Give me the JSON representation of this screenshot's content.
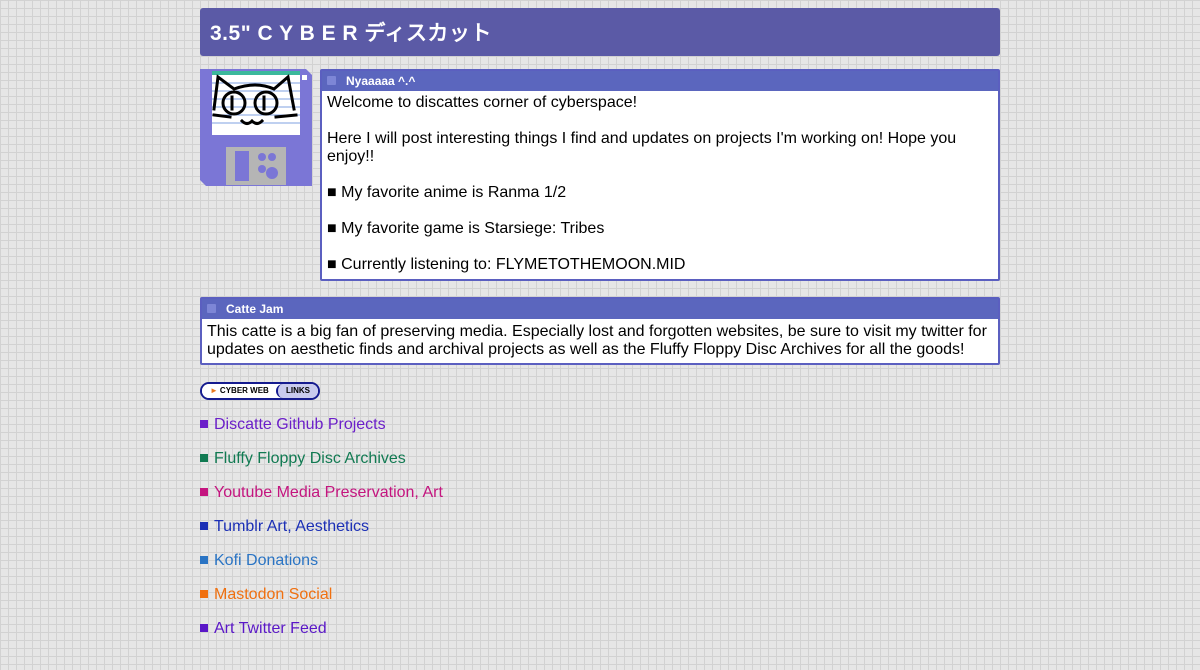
{
  "header": {
    "title": "3.5\" C Y B E R ディスカット"
  },
  "about_window": {
    "title": "Nyaaaaa ^.^",
    "paragraphs": [
      "Welcome to discattes corner of cyberspace!",
      "Here I will post interesting things I find and updates on projects I'm working on! Hope you enjoy!!",
      "■ My favorite anime is Ranma 1/2",
      "■ My favorite game is Starsiege: Tribes",
      "■ Currently listening to: FLYMETOTHEMOON.MID"
    ]
  },
  "jam_window": {
    "title": "Catte Jam",
    "text": "This catte is a big fan of preserving media. Especially lost and forgotten websites, be sure to visit my twitter for updates on aesthetic finds and archival projects as well as the Fluffy Floppy Disc Archives for all the goods!"
  },
  "badge": {
    "arrow": "►",
    "left": "CYBER WEB",
    "right": "LINKS"
  },
  "links": [
    {
      "label": "Discatte Github Projects",
      "color": "#6b1fc9"
    },
    {
      "label": "Fluffy Floppy Disc Archives",
      "color": "#117a52"
    },
    {
      "label": "Youtube Media Preservation, Art",
      "color": "#c4157f"
    },
    {
      "label": "Tumblr Art, Aesthetics",
      "color": "#1b2fb5"
    },
    {
      "label": "Kofi Donations",
      "color": "#2a74c4"
    },
    {
      "label": "Mastodon Social",
      "color": "#f07010"
    },
    {
      "label": "Art Twitter Feed",
      "color": "#5a17c7"
    }
  ],
  "icons": {
    "logo": "floppy-disk-cat-icon",
    "window": "window-control-icon",
    "bullet": "square-bullet"
  },
  "colors": {
    "header": "#5b5aa6",
    "window_border": "#5b5fc0",
    "window_title": "#5b66be",
    "floppy": "#7b76d6"
  }
}
